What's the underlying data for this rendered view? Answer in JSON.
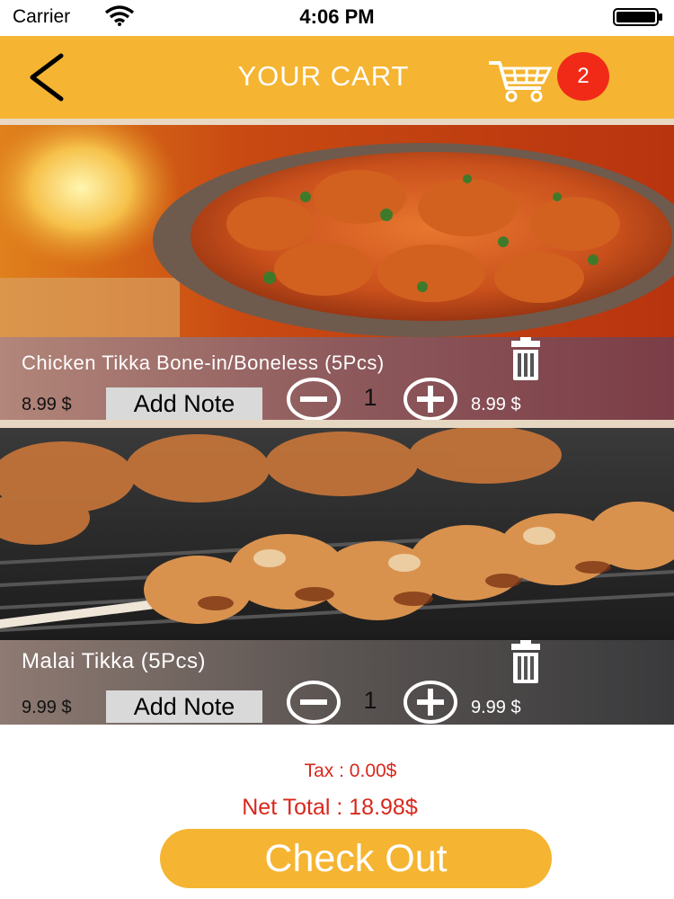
{
  "status_bar": {
    "carrier": "Carrier",
    "time": "4:06 PM"
  },
  "header": {
    "title": "YOUR CART",
    "cart_count": "2",
    "back_icon": "chevron-left-icon",
    "cart_icon": "shopping-cart-icon"
  },
  "items": [
    {
      "name": "Chicken Tikka Bone-in/Boneless (5Pcs)",
      "unit_price": "8.99 $",
      "add_note_label": "Add Note",
      "quantity": "1",
      "line_total": "8.99 $"
    },
    {
      "name": "Malai Tikka (5Pcs)",
      "unit_price": "9.99 $",
      "add_note_label": "Add Note",
      "quantity": "1",
      "line_total": "9.99 $"
    }
  ],
  "totals": {
    "tax": "Tax  : 0.00$",
    "net_total": "Net Total : 18.98$"
  },
  "checkout_label": "Check Out",
  "colors": {
    "accent": "#f5b431",
    "badge": "#f12a17",
    "total_text": "#d8281c"
  }
}
